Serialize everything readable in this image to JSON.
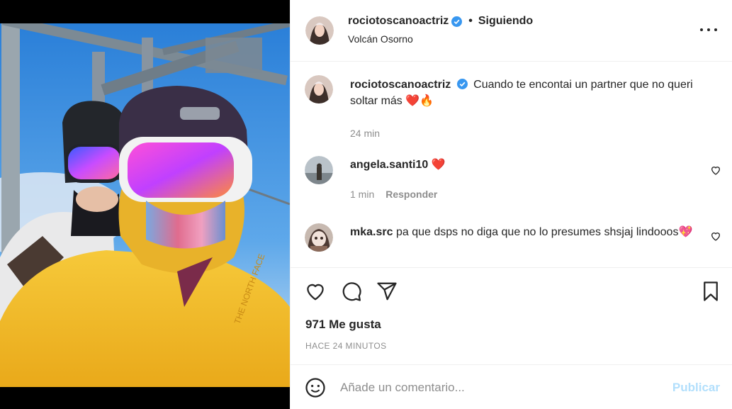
{
  "post": {
    "username": "rociotoscanoactriz",
    "follow_status": "Siguiendo",
    "separator": "•",
    "location": "Volcán Osorno",
    "caption": "Cuando te encontai un partner que no queri soltar más",
    "caption_emoji": "❤️🔥",
    "caption_time": "24 min"
  },
  "comments": [
    {
      "username": "angela.santi10",
      "text": "",
      "emoji": "❤️",
      "time": "1 min",
      "reply_label": "Responder"
    },
    {
      "username": "mka.src",
      "text": "pa que dsps no diga que no lo presumes shsjaj lindooos",
      "emoji": "💖"
    }
  ],
  "stats": {
    "likes": "971 Me gusta",
    "timestamp": "HACE 24 MINUTOS"
  },
  "composer": {
    "placeholder": "Añade un comentario...",
    "publish_label": "Publicar"
  },
  "colors": {
    "verified": "#3897f0",
    "publish_disabled": "#b2dffc",
    "muted": "#8e8e8e",
    "heart": "#ed4956"
  },
  "icons": [
    "verified-badge-icon",
    "more-options-icon",
    "heart-icon",
    "comment-icon",
    "share-icon",
    "bookmark-icon",
    "emoji-icon"
  ]
}
